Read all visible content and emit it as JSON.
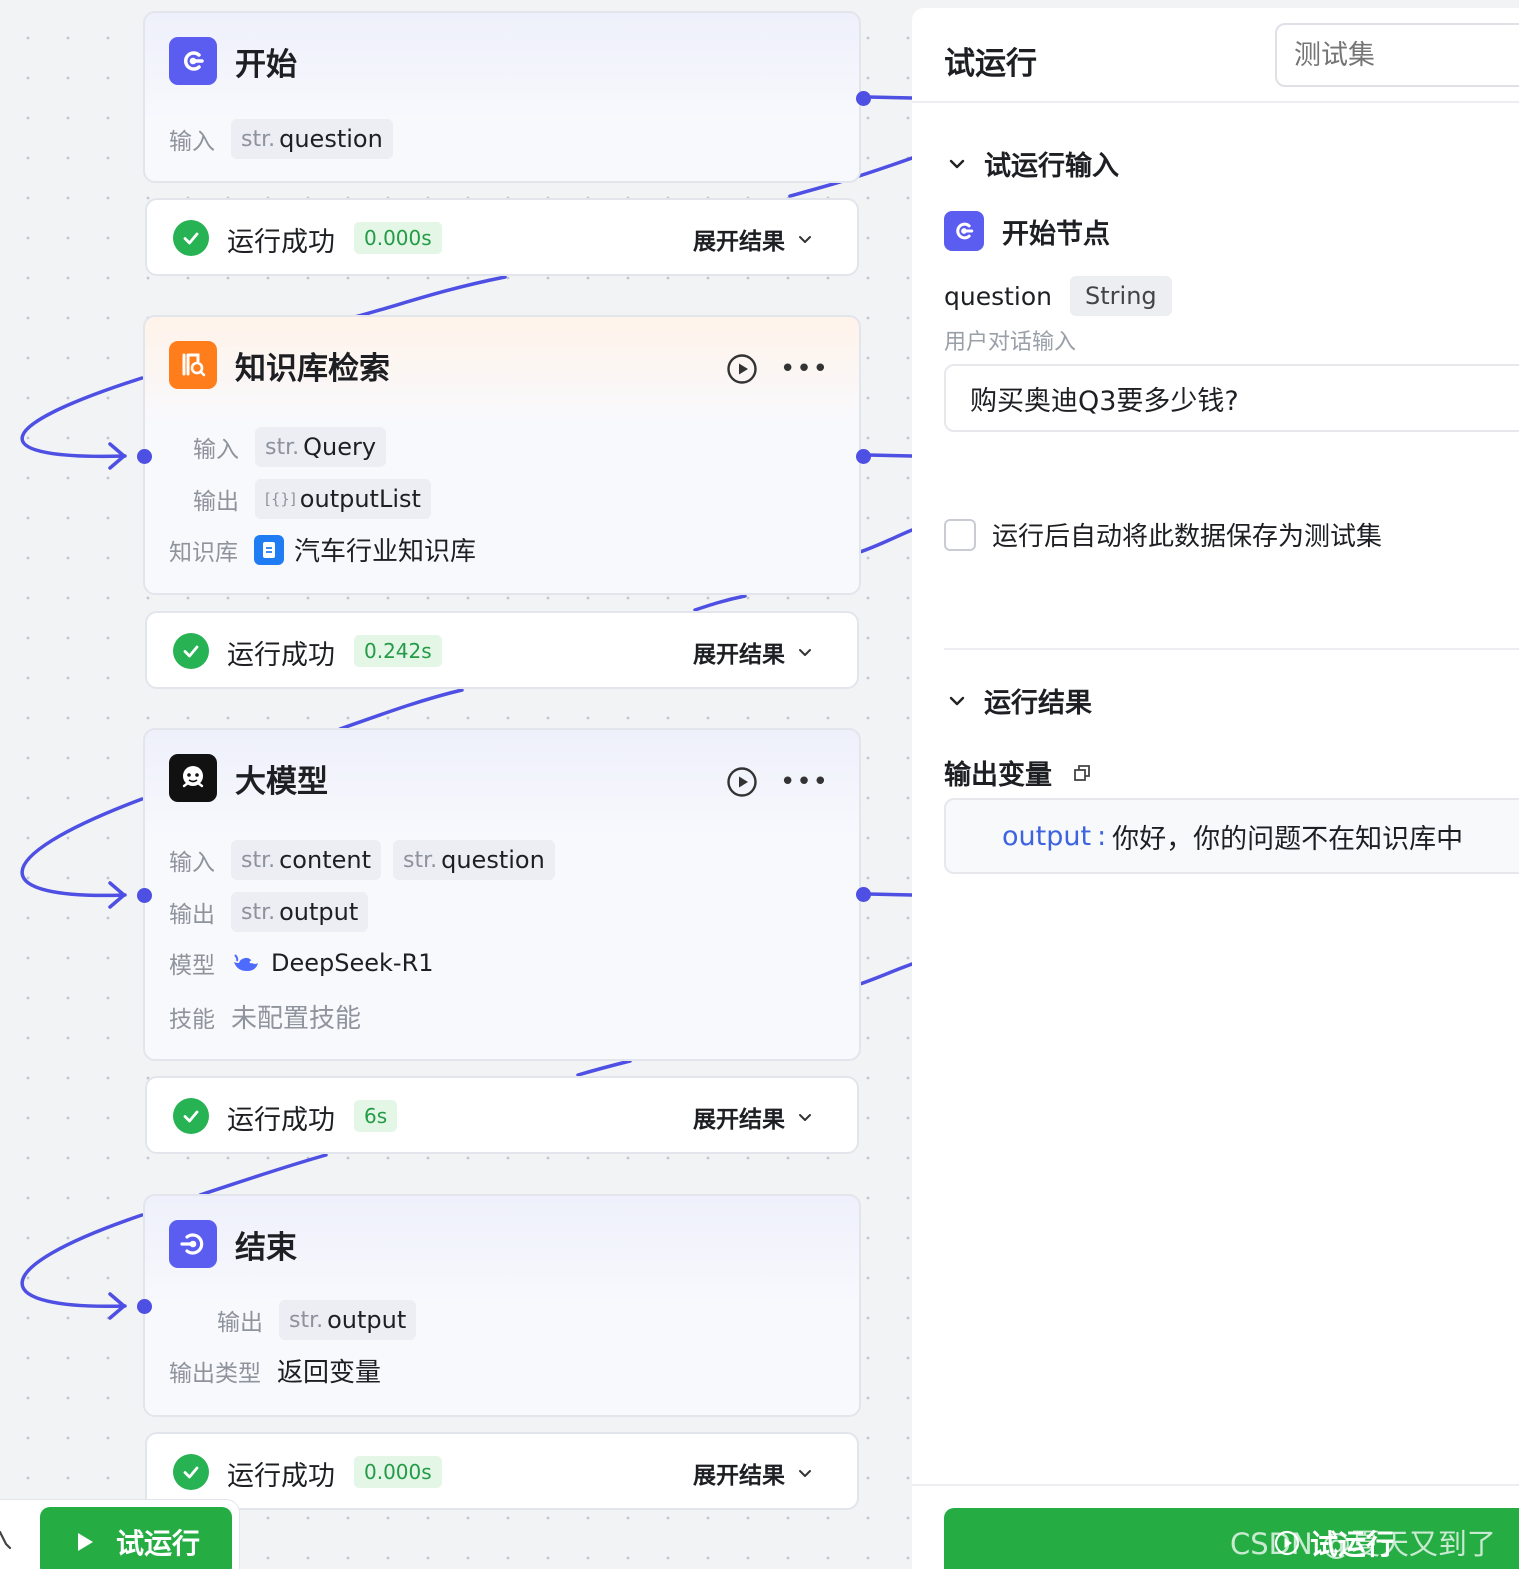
{
  "nodes": {
    "start": {
      "title": "开始",
      "input_label": "输入",
      "input_type": "str.",
      "input_name": "question"
    },
    "kb": {
      "title": "知识库检索",
      "input_label": "输入",
      "input_type": "str.",
      "input_name": "Query",
      "output_label": "输出",
      "output_type": "[{}]",
      "output_name": "outputList",
      "kb_label": "知识库",
      "kb_name": "汽车行业知识库"
    },
    "llm": {
      "title": "大模型",
      "input_label": "输入",
      "input_type_1": "str.",
      "input_name_1": "content",
      "input_type_2": "str.",
      "input_name_2": "question",
      "output_label": "输出",
      "output_type": "str.",
      "output_name": "output",
      "model_label": "模型",
      "model_name": "DeepSeek-R1",
      "skill_label": "技能",
      "skill_value": "未配置技能"
    },
    "end": {
      "title": "结束",
      "output_label": "输出",
      "output_type": "str.",
      "output_name": "output",
      "output_kind_label": "输出类型",
      "output_kind_value": "返回变量"
    }
  },
  "status": {
    "text": "运行成功",
    "expand": "展开结果",
    "times": [
      "0.000s",
      "0.242s",
      "6s",
      "0.000s"
    ]
  },
  "toolbar": {
    "run_label": "试运行"
  },
  "panel": {
    "title": "试运行",
    "testset_placeholder": "测试集",
    "input_section": "试运行输入",
    "start_node_label": "开始节点",
    "param_name": "question",
    "param_type": "String",
    "param_desc": "用户对话输入",
    "param_value": "购买奥迪Q3要多少钱?",
    "save_label": "运行后自动将此数据保存为测试集",
    "result_section": "运行结果",
    "output_vars_label": "输出变量",
    "output_key": "output",
    "output_sep": ":",
    "output_value": "你好，你的问题不在知识库中",
    "run_label": "试运行",
    "watermark": "CSDN @夏天又到了"
  },
  "colors": {
    "accent": "#4e4fe3",
    "success": "#25ad44",
    "kb_orange": "#ff7d1a",
    "link_blue": "#3d63e0"
  }
}
